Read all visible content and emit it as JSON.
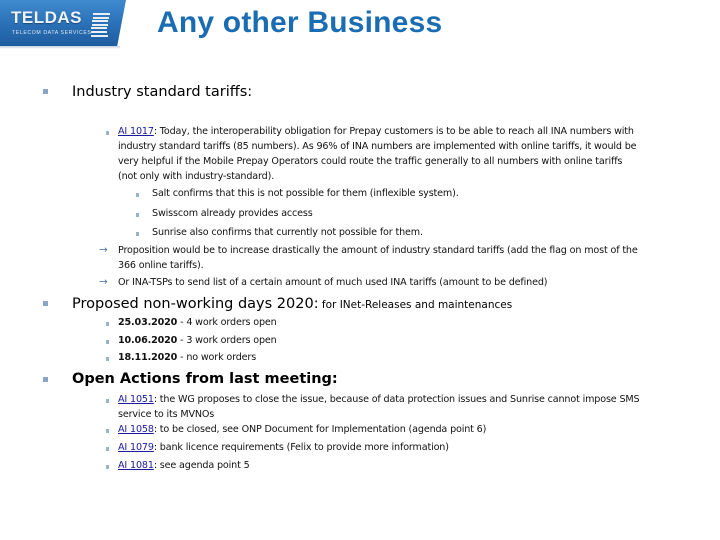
{
  "header": {
    "logo": {
      "name": "TELDAS",
      "tagline": "Telecom Data Services"
    },
    "title": "Any other Business"
  },
  "sections": {
    "tariffs": {
      "heading": "Industry standard tariffs:",
      "ai_link": "AI 1017",
      "ai_text_lines": [
        ": Today, the interoperability obligation for Prepay customers is to be able to reach all INA numbers with",
        "industry standard tariffs (85 numbers). As 96% of INA numbers are implemented with online tariffs, it would be",
        "very helpful if the Mobile Prepay Operators could route the traffic generally to all numbers with online tariffs",
        "(not only with industry-standard)."
      ],
      "sub_items": [
        "Salt confirms that this is not possible for them (inflexible system).",
        "Swisscom already provides access",
        "Sunrise also confirms that currently not possible for them."
      ],
      "arrows": [
        {
          "lines": [
            "Proposition would be to increase drastically the amount of industry standard tariffs (add the flag on most of the",
            "366 online tariffs)."
          ]
        },
        {
          "lines": [
            "Or INA-TSPs to send list of a certain amount of much used INA tariffs (amount to be defined)"
          ]
        }
      ]
    },
    "nonworking": {
      "heading": "Proposed non-working days 2020:",
      "heading_tail": " for INet-Releases and maintenances",
      "items": [
        {
          "date": "25.03.2020",
          "text": " - 4 work orders open"
        },
        {
          "date": "10.06.2020",
          "text": " - 3 work orders open"
        },
        {
          "date": "18.11.2020",
          "text": " - no work orders"
        }
      ]
    },
    "open_actions": {
      "heading": "Open Actions from last meeting:",
      "items": [
        {
          "link": "AI 1051",
          "lines": [
            ": the WG proposes to close the issue, because of data protection issues and Sunrise cannot impose SMS",
            "service to its MVNOs"
          ]
        },
        {
          "link": "AI 1058",
          "lines": [
            ": to be closed, see ONP Document for Implementation (agenda point 6)"
          ]
        },
        {
          "link": "AI 1079",
          "lines": [
            ": bank licence requirements (Felix to provide more information)"
          ]
        },
        {
          "link": "AI 1081",
          "lines": [
            ": see agenda point 5"
          ]
        }
      ]
    }
  },
  "icons": {
    "arrow": "→",
    "bullet_level1": "square-bullet",
    "bullet_level2": "square-bullet-small"
  },
  "colors": {
    "title": "#1b6db3",
    "logo_bg": "#2a6fb5",
    "bullet": "#8aa6c6",
    "link": "#1a1a9e",
    "arrow": "#4d7fb6"
  }
}
